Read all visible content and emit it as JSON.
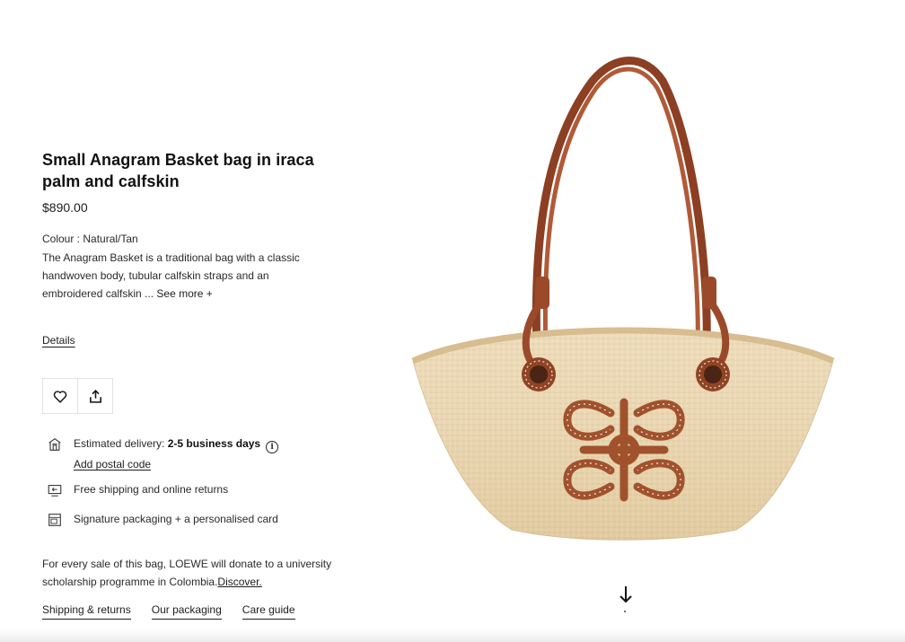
{
  "product": {
    "title": "Small Anagram Basket bag in iraca palm and calfskin",
    "price": "$890.00",
    "colour": "Colour : Natural/Tan",
    "description": "The Anagram Basket is a traditional bag with a classic handwoven body, tubular calfskin straps and an embroidered calfskin ...",
    "see_more": "See more +",
    "details_link": "Details"
  },
  "actions": {
    "wishlist_icon": "heart-icon",
    "share_icon": "share-icon"
  },
  "delivery": {
    "label": "Estimated delivery: ",
    "value": "2-5 business days",
    "info_glyph": "i",
    "postal_link": "Add postal code"
  },
  "shipping": {
    "label": "Free shipping and online returns"
  },
  "packaging": {
    "label": "Signature packaging + a personalised card"
  },
  "donation": {
    "text": "For every sale of this bag, LOEWE will donate to a university scholarship programme in Colombia.",
    "link": "Discover."
  },
  "footer_links": {
    "shipping_returns": "Shipping & returns",
    "packaging": "Our packaging",
    "care": "Care guide"
  },
  "colors": {
    "straw": "#ead5ad",
    "leather": "#9a4a2b",
    "text": "#1d1d1d"
  }
}
